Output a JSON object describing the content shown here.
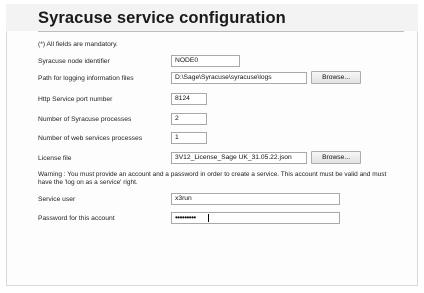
{
  "page": {
    "title": "Syracuse service configuration",
    "mandatory_note": "(*) All fields are mandatory."
  },
  "fields": [
    {
      "label": "Syracuse node identifier",
      "value": "NODE0"
    },
    {
      "label": "Path for logging information files",
      "value": "D:\\Sage\\Syracuse\\syracuse\\logs",
      "button": "Browse..."
    },
    {
      "label": "Http Service port number",
      "value": "8124"
    },
    {
      "label": "Number of Syracuse processes",
      "value": "2"
    },
    {
      "label": "Number of web services processes",
      "value": "1"
    },
    {
      "label": "License file",
      "value": "3V12_License_Sage UK_31.05.22.json",
      "button": "Browse..."
    }
  ],
  "warning": "Warning : You must provide an account and a password in order to create a service. This account must be valid and must have the 'log on as a service' right.",
  "service_user": {
    "label": "Service user",
    "value": "x3run"
  },
  "service_password": {
    "label": "Password for this account",
    "value": "•••••••••"
  }
}
